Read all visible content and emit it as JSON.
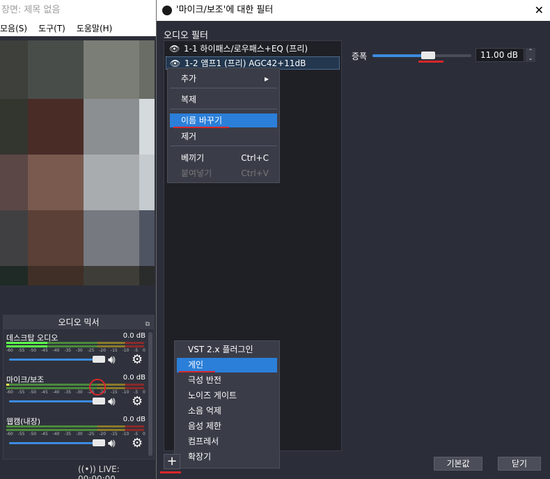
{
  "main": {
    "title": "장면: 제목 없음",
    "menu": [
      "모음(S)",
      "도구(T)",
      "도움말(H)"
    ],
    "mixer": {
      "title": "오디오 믹서",
      "tracks": [
        {
          "name": "데스크탑 오디오",
          "db": "0.0 dB"
        },
        {
          "name": "마이크/보조",
          "db": "0.0 dB"
        },
        {
          "name": "웹캠(내장)",
          "db": "0.0 dB"
        }
      ],
      "scale": [
        "-60",
        "-55",
        "-50",
        "-45",
        "-40",
        "-35",
        "-30",
        "-25",
        "-20",
        "-15",
        "-10",
        "-5",
        "0"
      ]
    },
    "live": "LIVE: 00:00:00"
  },
  "dialog": {
    "title": "'마이크/보조'에 대한 필터",
    "close": "✕",
    "audio_filter_label": "오디오 필터",
    "filters": [
      {
        "name": "1-1 하이패스/로우패스+EQ (프리)"
      },
      {
        "name": "1-2 앰프1 (프리) AGC42+11dB"
      }
    ],
    "context_menu": {
      "add": "추가",
      "duplicate": "복제",
      "rename": "이름 바꾸기",
      "remove": "제거",
      "copy": "베끼기",
      "copy_shortcut": "Ctrl+C",
      "paste": "붙여넣기",
      "paste_shortcut": "Ctrl+V"
    },
    "gain": {
      "label": "증폭",
      "value": "11.00 dB",
      "level": 0.56
    },
    "add_menu": [
      "VST 2.x 플러그인",
      "게인",
      "극성 반전",
      "노이즈 게이트",
      "소음 억제",
      "음성 제한",
      "컴프레서",
      "확장기"
    ],
    "buttons": {
      "defaults": "기본값",
      "close": "닫기"
    }
  },
  "colors": {
    "accent": "#2b7fd9",
    "annotation": "#d8262b",
    "background": "#2b2e38"
  }
}
